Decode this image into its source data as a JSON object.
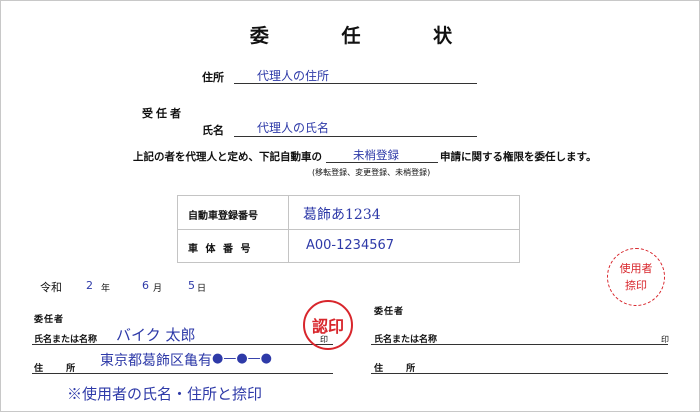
{
  "title": "委 任 状",
  "header": {
    "address_label": "住所",
    "address_value": "代理人の住所",
    "agent_label": "受任者",
    "name_label": "氏名",
    "name_value": "代理人の氏名"
  },
  "intro": {
    "before": "上記の者を代理人と定め、下記自動車の",
    "procedure": "未梢登録",
    "after": "申請に関する権限を委任します。",
    "note": "(移転登録、変更登録、未梢登録)"
  },
  "vehicle": {
    "reg_label": "自動車登録番号",
    "reg_value": "葛飾あ1234",
    "vin_label": "車 体 番 号",
    "vin_value": "A00-1234567"
  },
  "date": {
    "era": "令和",
    "year": "2",
    "year_unit": "年",
    "month": "6",
    "month_unit": "月",
    "day": "5",
    "day_unit": "日"
  },
  "left_signer": {
    "heading": "委任者",
    "name_label": "氏名または名称",
    "name_value": "バイク 太郎",
    "seal_mark": "印",
    "address_label": "住 所",
    "address_value": "東京都葛飾区亀有",
    "address_dots": "●—●—●",
    "stamp_text": "認印"
  },
  "right_signer": {
    "heading": "委任者",
    "name_label": "氏名または名称",
    "seal_mark": "印",
    "address_label": "住 所"
  },
  "user_stamp": {
    "line1": "使用者",
    "line2": "捺印"
  },
  "footnote": "※使用者の氏名・住所と捺印",
  "colors": {
    "ink_blue": "#2e3aa8",
    "stamp_red": "#d8262c"
  }
}
